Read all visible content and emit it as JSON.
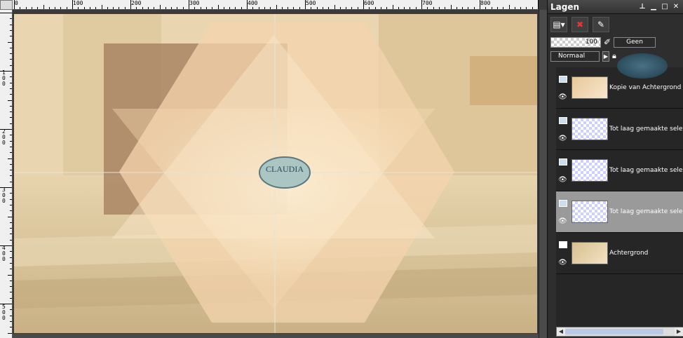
{
  "rulers": {
    "top_labels": [
      "0",
      "100",
      "200",
      "300",
      "400",
      "500",
      "600",
      "700",
      "800"
    ],
    "left_labels": [
      "1 0 0",
      "2 0 0",
      "3 0 0",
      "4 0 0",
      "5 0 0"
    ]
  },
  "canvas": {
    "watermark_text": "CLAUDIA"
  },
  "layers_panel": {
    "title": "Lagen",
    "opacity_value": "100",
    "mask_label": "Geen",
    "blend_mode": "Normaal",
    "layers": [
      {
        "name": "Kopie van Achtergrond",
        "selected": false
      },
      {
        "name": "Tot laag gemaakte selectie",
        "selected": false
      },
      {
        "name": "Tot laag gemaakte selectie",
        "selected": false
      },
      {
        "name": "Tot laag gemaakte selectie",
        "selected": true
      },
      {
        "name": "Achtergrond",
        "selected": false
      }
    ]
  },
  "colors": {
    "panel_bg": "#2e2e2e",
    "selected_row": "#9a9a9a",
    "canvas_tan": "#d8c39a",
    "canvas_light": "#fdf1d6"
  }
}
